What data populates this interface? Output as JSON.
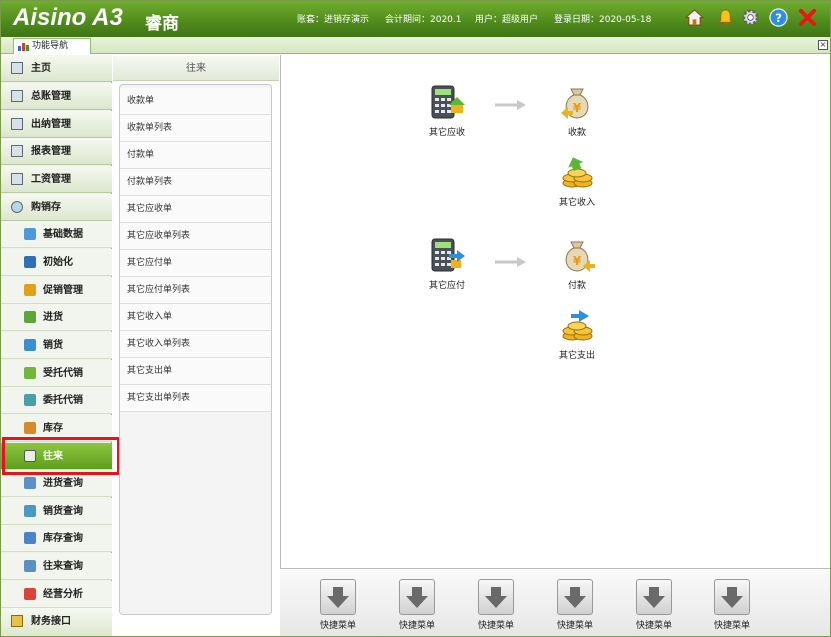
{
  "header": {
    "brand": "Aisino A3",
    "brand_sub": "睿商",
    "account": "账套：进销存演示",
    "period": "会计期间：2020.1",
    "user": "用户：超级用户",
    "login_date": "登录日期：2020-05-18",
    "icons": [
      "home-icon",
      "bell-icon",
      "gear-icon",
      "help-icon",
      "close-icon"
    ]
  },
  "tab": {
    "label": "功能导航"
  },
  "sidebar": {
    "main_items": [
      {
        "label": "主页"
      },
      {
        "label": "总账管理"
      },
      {
        "label": "出纳管理"
      },
      {
        "label": "报表管理"
      },
      {
        "label": "工资管理"
      },
      {
        "label": "购销存"
      }
    ],
    "sub_items": [
      {
        "label": "基础数据"
      },
      {
        "label": "初始化"
      },
      {
        "label": "促销管理"
      },
      {
        "label": "进货"
      },
      {
        "label": "销货"
      },
      {
        "label": "受托代销"
      },
      {
        "label": "委托代销"
      },
      {
        "label": "库存"
      },
      {
        "label": "往来"
      },
      {
        "label": "进货查询"
      },
      {
        "label": "销货查询"
      },
      {
        "label": "库存查询"
      },
      {
        "label": "往来查询"
      },
      {
        "label": "经营分析"
      }
    ],
    "bottom_item": {
      "label": "财务接口"
    },
    "active": "往来"
  },
  "submenu": {
    "title": "往来",
    "items": [
      {
        "label": "收款单"
      },
      {
        "label": "收款单列表"
      },
      {
        "label": "付款单"
      },
      {
        "label": "付款单列表"
      },
      {
        "label": "其它应收单"
      },
      {
        "label": "其它应收单列表"
      },
      {
        "label": "其它应付单"
      },
      {
        "label": "其它应付单列表"
      },
      {
        "label": "其它收入单"
      },
      {
        "label": "其它收入单列表"
      },
      {
        "label": "其它支出单"
      },
      {
        "label": "其它支出单列表"
      }
    ]
  },
  "flow": {
    "other_receivable": "其它应收",
    "receipt": "收款",
    "other_income": "其它收入",
    "other_payable": "其它应付",
    "payment": "付款",
    "other_expense": "其它支出"
  },
  "quickbar": {
    "items": [
      {
        "label": "快捷菜单"
      },
      {
        "label": "快捷菜单"
      },
      {
        "label": "快捷菜单"
      },
      {
        "label": "快捷菜单"
      },
      {
        "label": "快捷菜单"
      },
      {
        "label": "快捷菜单"
      }
    ]
  },
  "colors": {
    "header_green": "#4f8a1c",
    "active_green": "#6aaa2a",
    "highlight_red": "#e8141b"
  }
}
